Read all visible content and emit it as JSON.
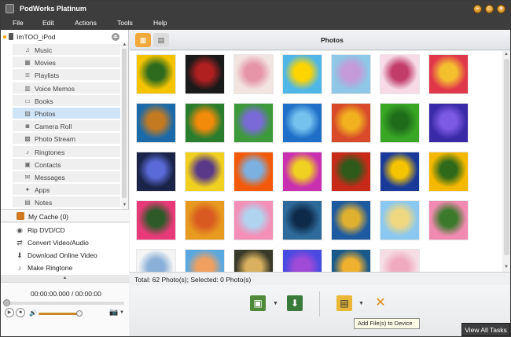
{
  "app": {
    "title": "PodWorks Platinum"
  },
  "menu": [
    "File",
    "Edit",
    "Actions",
    "Tools",
    "Help"
  ],
  "sidebar": {
    "device": "ImTOO_iPod",
    "items": [
      {
        "label": "Music",
        "icon": "music-note-icon"
      },
      {
        "label": "Movies",
        "icon": "film-icon"
      },
      {
        "label": "Playlists",
        "icon": "playlist-icon"
      },
      {
        "label": "Voice Memos",
        "icon": "voice-memo-icon"
      },
      {
        "label": "Books",
        "icon": "book-icon"
      },
      {
        "label": "Photos",
        "icon": "photo-icon",
        "selected": true
      },
      {
        "label": "Camera Roll",
        "icon": "camera-icon"
      },
      {
        "label": "Photo Stream",
        "icon": "photo-stream-icon"
      },
      {
        "label": "Ringtones",
        "icon": "bell-icon"
      },
      {
        "label": "Contacts",
        "icon": "contacts-icon"
      },
      {
        "label": "Messages",
        "icon": "message-icon"
      },
      {
        "label": "Apps",
        "icon": "apps-icon"
      },
      {
        "label": "Notes",
        "icon": "notes-icon"
      }
    ],
    "cache": "My Cache (0)",
    "tasks": [
      {
        "label": "Rip DVD/CD",
        "icon": "disc-icon"
      },
      {
        "label": "Convert Video/Audio",
        "icon": "convert-icon"
      },
      {
        "label": "Download Online Video",
        "icon": "download-icon"
      },
      {
        "label": "Make Ringtone",
        "icon": "ringtone-bell-icon"
      }
    ]
  },
  "player": {
    "time": "00:00:00.000 / 00:00:00",
    "volume": 0.9,
    "seek": 0
  },
  "main": {
    "section_title": "Photos",
    "status": "Total: 62 Photo(s); Selected: 0 Photo(s)",
    "tooltip": "Add File(s) to Device"
  },
  "photos": [
    {
      "colors": [
        "#f5c400",
        "#2e6b1e"
      ]
    },
    {
      "colors": [
        "#1a1a1a",
        "#b12020"
      ]
    },
    {
      "colors": [
        "#f2e4e0",
        "#e694a8"
      ]
    },
    {
      "colors": [
        "#4fb7e8",
        "#ffd400"
      ]
    },
    {
      "colors": [
        "#8fc7e6",
        "#c49ad8"
      ]
    },
    {
      "colors": [
        "#f6dbe6",
        "#c23c6a"
      ]
    },
    {
      "colors": [
        "#e0384a",
        "#f5c030"
      ]
    },
    {
      "colors": [
        "#1d6aa8",
        "#c47a20"
      ]
    },
    {
      "colors": [
        "#2b7d2e",
        "#f28a0a"
      ]
    },
    {
      "colors": [
        "#3c9a3a",
        "#7a6ad8"
      ]
    },
    {
      "colors": [
        "#1f6fc8",
        "#76c2ee"
      ]
    },
    {
      "colors": [
        "#d84a2a",
        "#f2b220"
      ]
    },
    {
      "colors": [
        "#3aa626",
        "#1f6d1a"
      ]
    },
    {
      "colors": [
        "#3a2aa8",
        "#7c5ae4"
      ]
    },
    {
      "colors": [
        "#1a2448",
        "#5a6ad8"
      ]
    },
    {
      "colors": [
        "#f0d020",
        "#5a3a88"
      ]
    },
    {
      "colors": [
        "#f25a0a",
        "#7cb0e0"
      ]
    },
    {
      "colors": [
        "#c830b0",
        "#f0d020"
      ]
    },
    {
      "colors": [
        "#c82a1a",
        "#2e5a1a"
      ]
    },
    {
      "colors": [
        "#1a3a9a",
        "#f5c400"
      ]
    },
    {
      "colors": [
        "#f5b800",
        "#2e6a1a"
      ]
    },
    {
      "colors": [
        "#e83a78",
        "#2e5a2a"
      ]
    },
    {
      "colors": [
        "#e89a20",
        "#d85a20"
      ]
    },
    {
      "colors": [
        "#f490b8",
        "#b0d4f0"
      ]
    },
    {
      "colors": [
        "#2e6a9a",
        "#0e2a4a"
      ]
    },
    {
      "colors": [
        "#1e5aa0",
        "#e0b030"
      ]
    },
    {
      "colors": [
        "#8ac8f0",
        "#f0d880"
      ]
    },
    {
      "colors": [
        "#f08ab0",
        "#3a7a2a"
      ]
    },
    {
      "colors": [
        "#f4f4f4",
        "#8ab0d8"
      ]
    },
    {
      "colors": [
        "#5aa8e0",
        "#f0a060"
      ]
    },
    {
      "colors": [
        "#3a3a2a",
        "#d8b060"
      ]
    },
    {
      "colors": [
        "#4a4ae0",
        "#a04ad8"
      ]
    },
    {
      "colors": [
        "#1a5a8a",
        "#f0b030"
      ]
    },
    {
      "colors": [
        "#f6dde4",
        "#f0aac0"
      ]
    }
  ],
  "colors": {
    "accent": "#f2a93b",
    "chrome": "#3d3d3d",
    "selection": "#cfe4f7"
  },
  "buttons": {
    "view_all": "View All Tasks"
  }
}
